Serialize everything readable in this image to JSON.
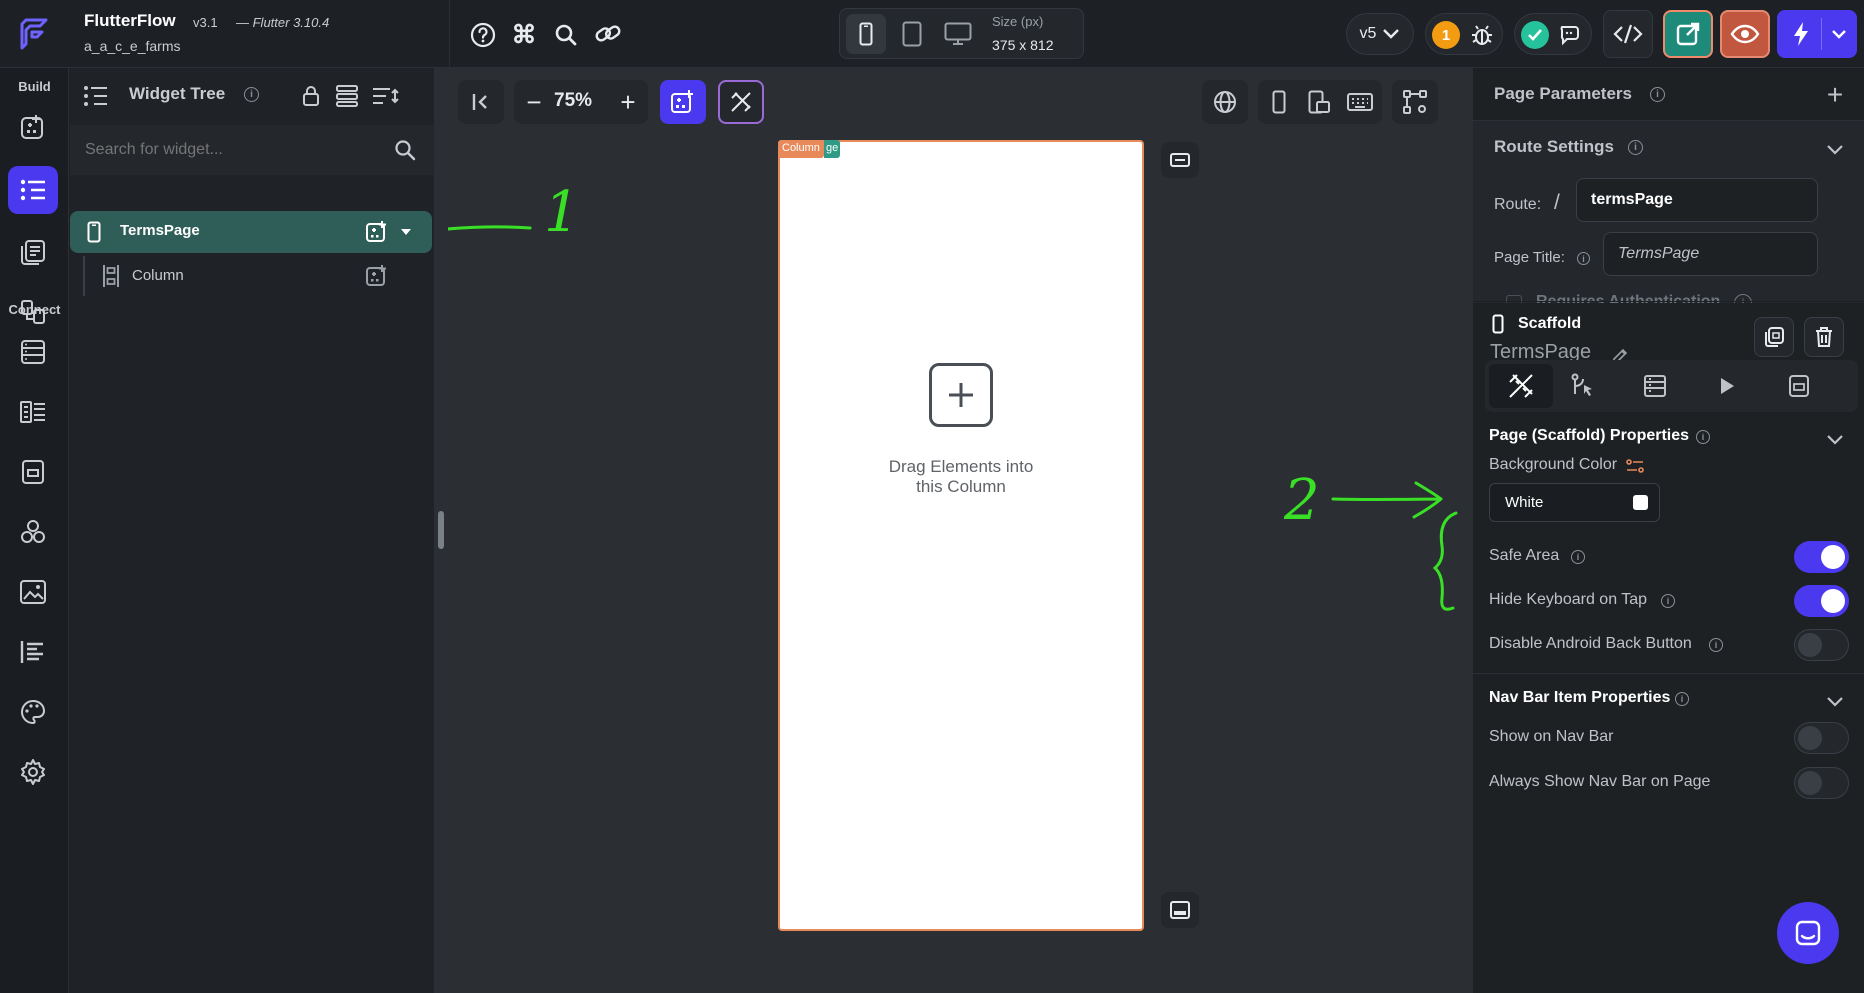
{
  "app": {
    "name": "FlutterFlow",
    "version": "v3.1",
    "flutter": "— Flutter 3.10.4",
    "project": "a_a_c_e_farms"
  },
  "topbar": {
    "size_label": "Size (px)",
    "size_value": "375 x 812",
    "version_select": "v5",
    "notification_count": "1"
  },
  "rail": {
    "build_label": "Build",
    "connect_label": "Connect"
  },
  "widget_tree": {
    "title": "Widget Tree",
    "search_placeholder": "Search for widget...",
    "page_item": "TermsPage",
    "child_item": "Column"
  },
  "canvas": {
    "zoom": "75%",
    "column_tag": "Column",
    "column_tag_tail": "ge",
    "drop_hint_line1": "Drag Elements into",
    "drop_hint_line2": "this Column"
  },
  "annotations": {
    "one": "1",
    "two": "2"
  },
  "right_panel": {
    "page_parameters": "Page Parameters",
    "route_settings": "Route Settings",
    "route_label": "Route:",
    "route_slash": "/",
    "route_value": "termsPage",
    "page_title_label": "Page Title:",
    "page_title_value": "TermsPage",
    "requires_auth": "Requires Authentication",
    "scaffold_label": "Scaffold",
    "scaffold_name": "TermsPage",
    "scaffold_props_title": "Page (Scaffold) Properties",
    "bg_color_label": "Background Color",
    "bg_color_value": "White",
    "safe_area": "Safe Area",
    "hide_keyboard": "Hide Keyboard on Tap",
    "disable_back": "Disable Android Back Button",
    "nav_bar_title": "Nav Bar Item Properties",
    "show_on_nav": "Show on Nav Bar",
    "always_show_nav": "Always Show Nav Bar on Page"
  },
  "colors": {
    "accent": "#4b39ef",
    "selected_row": "#2f5e58",
    "annotation_green": "#39e026",
    "column_tag": "#e8895a"
  },
  "toggles": {
    "safe_area": true,
    "hide_keyboard": true,
    "disable_back": false,
    "show_on_nav": false,
    "always_show_nav": false
  }
}
